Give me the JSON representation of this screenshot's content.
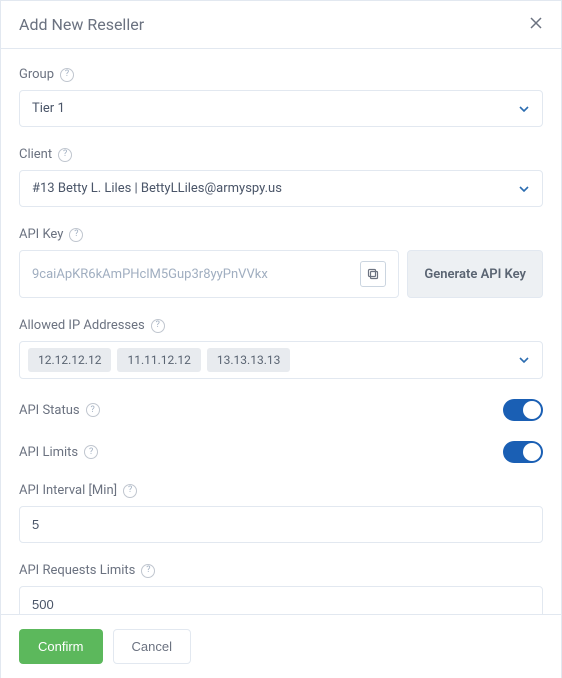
{
  "modal": {
    "title": "Add New Reseller"
  },
  "fields": {
    "group": {
      "label": "Group",
      "value": "Tier 1"
    },
    "client": {
      "label": "Client",
      "value": "#13 Betty L. Liles | BettyLLiles@armyspy.us"
    },
    "api_key": {
      "label": "API Key",
      "placeholder": "9caiApKR6kAmPHclM5Gup3r8yyPnVVkx",
      "generate_label": "Generate API Key"
    },
    "allowed_ips": {
      "label": "Allowed IP Addresses",
      "tags": [
        "12.12.12.12",
        "11.11.12.12",
        "13.13.13.13"
      ]
    },
    "api_status": {
      "label": "API Status",
      "value": true
    },
    "api_limits": {
      "label": "API Limits",
      "value": true
    },
    "api_interval": {
      "label": "API Interval [Min]",
      "value": "5"
    },
    "api_requests": {
      "label": "API Requests Limits",
      "value": "500"
    }
  },
  "footer": {
    "confirm": "Confirm",
    "cancel": "Cancel"
  }
}
